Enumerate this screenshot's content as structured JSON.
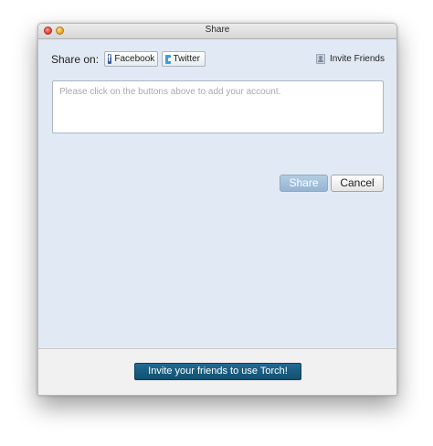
{
  "window": {
    "title": "Share"
  },
  "share_bar": {
    "label": "Share on:",
    "facebook_label": "Facebook",
    "twitter_label": "Twitter",
    "invite_friends_label": "Invite Friends"
  },
  "message": {
    "placeholder": "Please click on the buttons above to add your account.",
    "value": ""
  },
  "actions": {
    "share_label": "Share",
    "cancel_label": "Cancel"
  },
  "footer": {
    "invite_button_label": "Invite your friends to use Torch!"
  },
  "colors": {
    "content_background": "#e1eaf4",
    "footer_background": "#f1f1f1",
    "share_button": "#95b5d1",
    "invite_button": "#1a5c82",
    "facebook_brand": "#3b5998",
    "twitter_brand": "#3d9fd8"
  },
  "icons": {
    "facebook": "facebook-icon",
    "twitter": "twitter-icon",
    "invite_friends": "person-icon"
  }
}
